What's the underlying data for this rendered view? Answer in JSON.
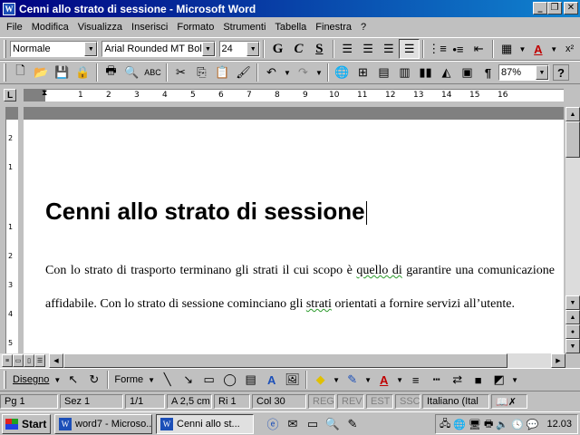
{
  "window": {
    "title": "Cenni allo strato di sessione - Microsoft Word",
    "app_icon": "W",
    "controls": {
      "minimize": "_",
      "restore": "❐",
      "close": "✕"
    }
  },
  "menu": {
    "items": [
      {
        "key": "file",
        "label": "File"
      },
      {
        "key": "modifica",
        "label": "Modifica"
      },
      {
        "key": "visualizza",
        "label": "Visualizza"
      },
      {
        "key": "inserisci",
        "label": "Inserisci"
      },
      {
        "key": "formato",
        "label": "Formato"
      },
      {
        "key": "strumenti",
        "label": "Strumenti"
      },
      {
        "key": "tabella",
        "label": "Tabella"
      },
      {
        "key": "finestra",
        "label": "Finestra"
      },
      {
        "key": "help",
        "label": "?"
      }
    ]
  },
  "format_toolbar": {
    "style": "Normale",
    "font": "Arial Rounded MT Bold",
    "size": "24",
    "bold": "G",
    "italic": "C",
    "underline": "S",
    "color_glyph": "A",
    "superscript": "x²"
  },
  "standard_toolbar": {
    "zoom": "87%",
    "help_glyph": "?"
  },
  "ruler": {
    "corner": "L",
    "ticks": [
      "1",
      "2",
      "3",
      "4",
      "5",
      "6",
      "7",
      "8",
      "9",
      "10",
      "11",
      "12",
      "13",
      "14",
      "15",
      "16"
    ],
    "vticks": [
      "2",
      "1",
      "1",
      "2",
      "3",
      "4",
      "5"
    ]
  },
  "document": {
    "heading": "Cenni allo strato di sessione",
    "paragraph_before": "Con lo strato di trasporto terminano gli strati il cui scopo è ",
    "paragraph_flag1": "quello di",
    "paragraph_mid": " garantire una comunicazione affidabile. Con lo strato di sessione cominciano gli ",
    "paragraph_flag2": "strati",
    "paragraph_after": " orientati a fornire servizi all’utente."
  },
  "draw_toolbar": {
    "draw_label": "Disegno",
    "shapes_label": "Forme"
  },
  "status": {
    "page": "Pg 1",
    "section": "Sez 1",
    "pages": "1/1",
    "position": "A 2,5 cm",
    "line": "Ri 1",
    "column": "Col 30",
    "rec": "REG",
    "rev": "REV",
    "ext": "EST",
    "ovr": "SSC",
    "language": "Italiano (Ital"
  },
  "taskbar": {
    "start": "Start",
    "tasks": [
      {
        "label": "word7 - Microso..."
      },
      {
        "label": "Cenni allo st..."
      }
    ],
    "clock": "12.03"
  }
}
